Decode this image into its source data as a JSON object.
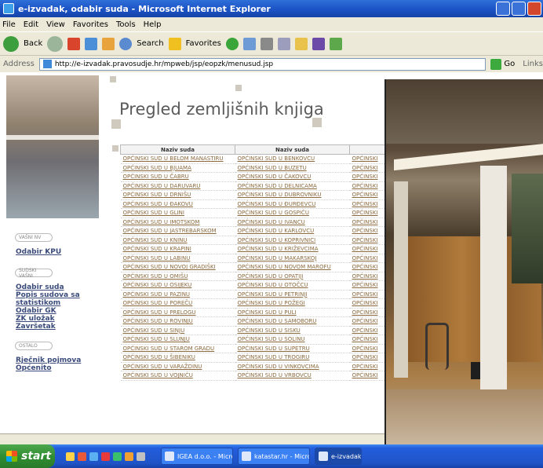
{
  "window": {
    "title": "e-izvadak, odabir suda - Microsoft Internet Explorer"
  },
  "menu": [
    "File",
    "Edit",
    "View",
    "Favorites",
    "Tools",
    "Help"
  ],
  "toolbar": {
    "back": "Back",
    "search": "Search",
    "favorites": "Favorites"
  },
  "address": {
    "label": "Address",
    "url": "http://e-izvadak.pravosudje.hr/mpweb/jsp/eopzk/menusud.jsp",
    "go": "Go",
    "links": "Links"
  },
  "page": {
    "title": "Pregled zemljišnih knjiga",
    "nav": {
      "pill1": "VAŠNI NV",
      "kpu": "Odabir KPU",
      "pill2": "SUDSKI VAŠNI",
      "links": [
        "Odabir suda",
        "Popis sudova sa statistikom",
        "Odabir GK",
        "ZK uložak",
        "Završetak"
      ],
      "pill3": "OSTALO",
      "links2": [
        "Rječnik pojmova",
        "Općenito"
      ]
    },
    "table": {
      "headers": [
        "Naziv suda",
        "Naziv suda",
        ""
      ],
      "col1": [
        "OPĆINSKI SUD U BELOM MANASTIRU",
        "OPĆINSKI SUD U BJUAMA",
        "OPĆINSKI SUD U ČABRU",
        "OPĆINSKI SUD U DARUVARU",
        "OPĆINSKI SUD U DRNIŠU",
        "OPĆINSKI SUD U ĐAKOVU",
        "OPĆINSKI SUD U GLINI",
        "OPĆINSKI SUD U IMOTSKOM",
        "OPĆINSKI SUD U JASTREBARSKOM",
        "OPĆINSKI SUD U KNINU",
        "OPĆINSKI SUD U KRAPINI",
        "OPĆINSKI SUD U LABINU",
        "OPĆINSKI SUD U NOVOJ GRADIŠKI",
        "OPĆINSKI SUD U OMIŠU",
        "OPĆINSKI SUD U OSIJEKU",
        "OPĆINSKI SUD U PAZINU",
        "OPĆINSKI SUD U POREČU",
        "OPĆINSKI SUD U PRELOGU",
        "OPĆINSKI SUD U ROVINJU",
        "OPĆINSKI SUD U SINJU",
        "OPĆINSKI SUD U SLUNJU",
        "OPĆINSKI SUD U STAROM GRADU",
        "OPĆINSKI SUD U ŠIBENIKU",
        "OPĆINSKI SUD U VARAŽDINU",
        "OPĆINSKI SUD U VOJNIĆU"
      ],
      "col2": [
        "OPĆINSKI SUD U BENKOVCU",
        "OPĆINSKI SUD U BUZETU",
        "OPĆINSKI SUD U ČAKOVCU",
        "OPĆINSKI SUD U DELNICAMA",
        "OPĆINSKI SUD U DUBROVNIKU",
        "OPĆINSKI SUD U ĐURĐEVCU",
        "OPĆINSKI SUD U GOSPIĆU",
        "OPĆINSKI SUD U IVANCU",
        "OPĆINSKI SUD U KARLOVCU",
        "OPĆINSKI SUD U KOPRIVNICI",
        "OPĆINSKI SUD U KRIŽEVCIMA",
        "OPĆINSKI SUD U MAKARSKOJ",
        "OPĆINSKI SUD U NOVOM MAROFU",
        "OPĆINSKI SUD U OPATIJI",
        "OPĆINSKI SUD U OTOČCU",
        "OPĆINSKI SUD U PETRINJI",
        "OPĆINSKI SUD U POŽEGI",
        "OPĆINSKI SUD U PULI",
        "OPĆINSKI SUD U SAMOBORU",
        "OPĆINSKI SUD U SISKU",
        "OPĆINSKI SUD U SOLINU",
        "OPĆINSKI SUD U SUPETRU",
        "OPĆINSKI SUD U TROGIRU",
        "OPĆINSKI SUD U VINKOVCIMA",
        "OPĆINSKI SUD U VRBOVCU"
      ],
      "col3_text": "OPĆINSKI"
    }
  },
  "taskbar": {
    "start": "start",
    "tasks": [
      "IGEA d.o.o. - Microso...",
      "katastar.hr - Microsof...",
      "e-izvadak"
    ]
  }
}
